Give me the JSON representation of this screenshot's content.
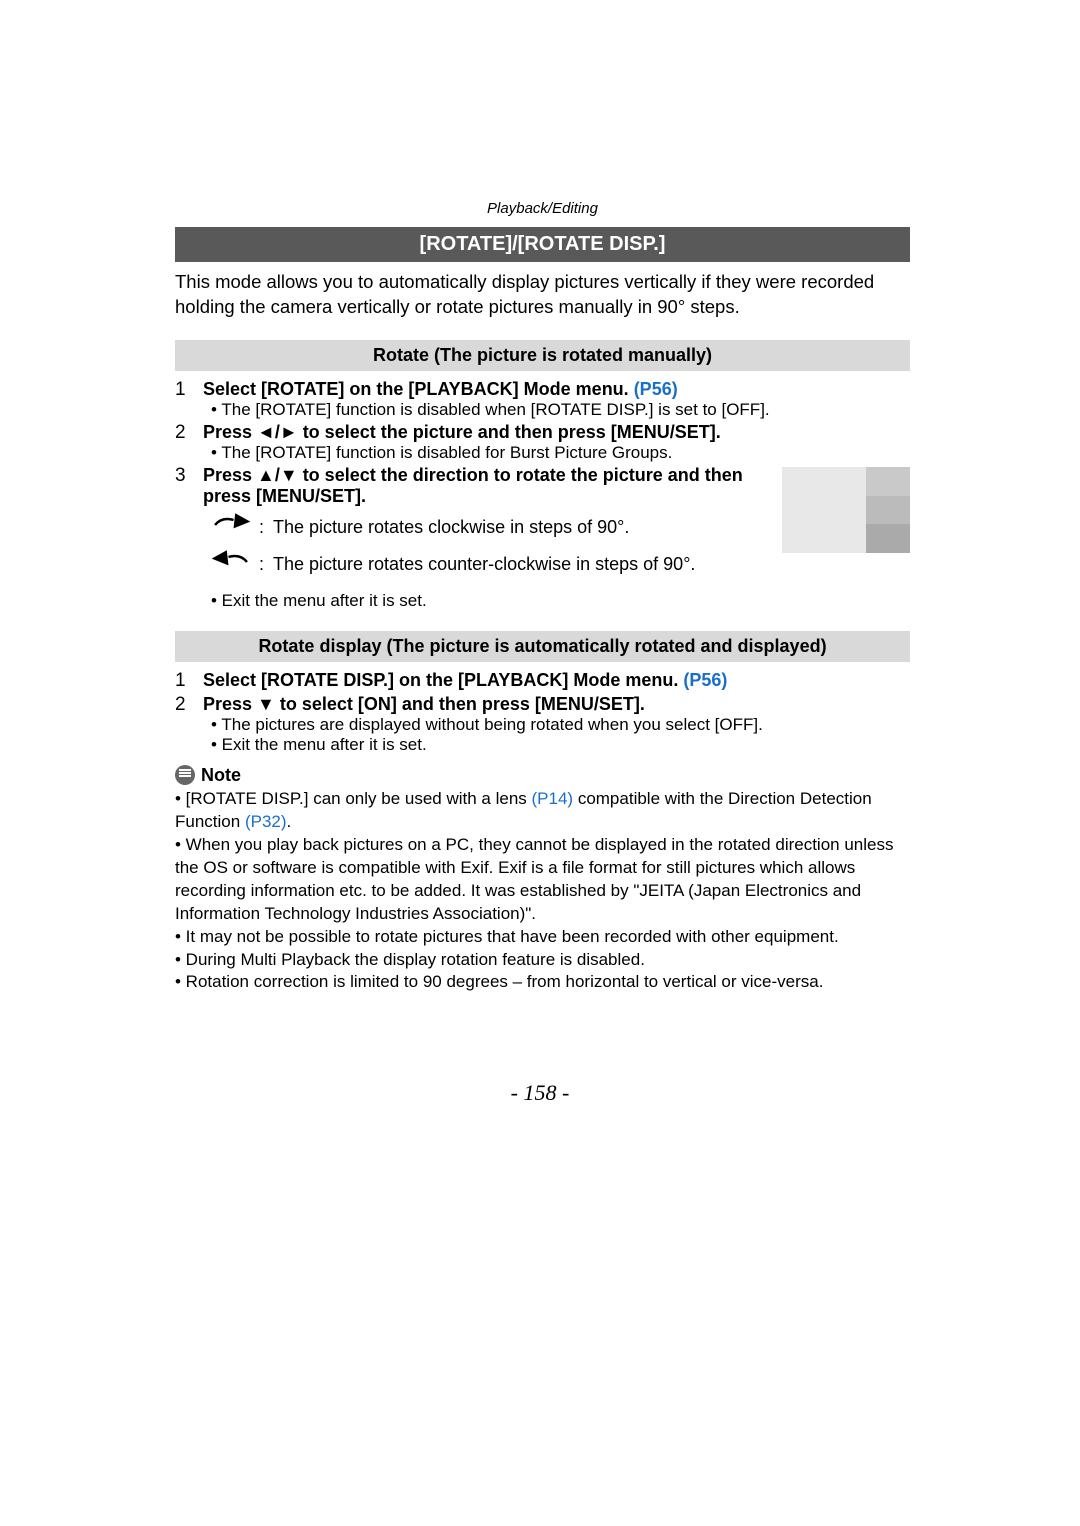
{
  "breadcrumb": "Playback/Editing",
  "title": "[ROTATE]/[ROTATE DISP.]",
  "intro": "This mode allows you to automatically display pictures vertically if they were recorded holding the camera vertically or rotate pictures manually in 90° steps.",
  "section1": {
    "banner": "Rotate (The picture is rotated manually)",
    "step1_num": "1",
    "step1_bold": "Select [ROTATE] on the [PLAYBACK] Mode menu. ",
    "step1_link": "(P56)",
    "step1_bullet": "• The [ROTATE] function is disabled when [ROTATE DISP.] is set to [OFF].",
    "step2_num": "2",
    "step2_bold_a": "Press ",
    "step2_bold_b": " to select the picture and then press [MENU/SET].",
    "step2_bullet": "• The [ROTATE] function is disabled for Burst Picture Groups.",
    "step3_num": "3",
    "step3_bold_a": "Press ",
    "step3_bold_b": " to select the direction to rotate the picture and then press [MENU/SET].",
    "rotate_cw": "The picture rotates clockwise in steps of 90°.",
    "rotate_ccw": "The picture rotates counter-clockwise in steps of 90°.",
    "exit_bullet": "• Exit the menu after it is set."
  },
  "section2": {
    "banner": "Rotate display (The picture is automatically rotated and displayed)",
    "step1_num": "1",
    "step1_bold": "Select [ROTATE DISP.] on the [PLAYBACK] Mode menu. ",
    "step1_link": "(P56)",
    "step2_num": "2",
    "step2_bold_a": "Press ",
    "step2_bold_b": " to select [ON] and then press [MENU/SET].",
    "step2_bullet1": "• The pictures are displayed without being rotated when you select [OFF].",
    "step2_bullet2": "• Exit the menu after it is set."
  },
  "note_label": "Note",
  "notes": {
    "n1a": "• [ROTATE DISP.] can only be used with a lens ",
    "n1link1": "(P14)",
    "n1b": " compatible with the Direction Detection Function ",
    "n1link2": "(P32)",
    "n1c": ".",
    "n2": "• When you play back pictures on a PC, they cannot be displayed in the rotated direction unless the OS or software is compatible with Exif. Exif is a file format for still pictures which allows recording information etc. to be added. It was established by \"JEITA (Japan Electronics and Information Technology Industries Association)\".",
    "n3": "• It may not be possible to rotate pictures that have been recorded with other equipment.",
    "n4": "• During Multi Playback the display rotation feature is disabled.",
    "n5": "• Rotation correction is limited to 90 degrees – from horizontal to vertical or vice-versa."
  },
  "page_num": "- 158 -"
}
